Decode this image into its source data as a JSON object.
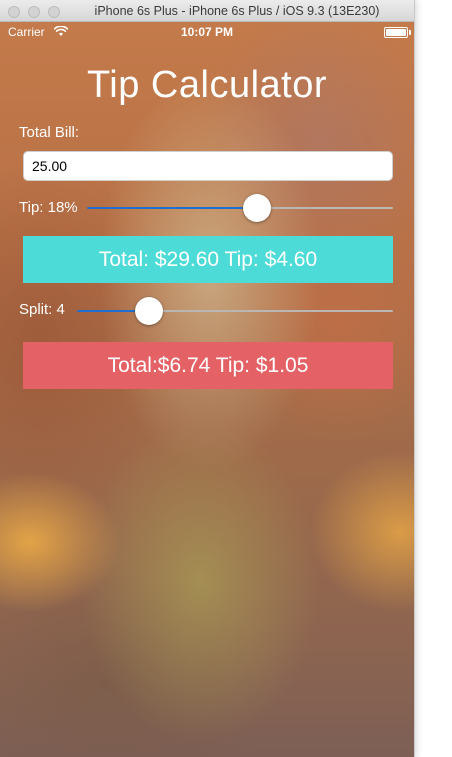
{
  "window": {
    "title": "iPhone 6s Plus - iPhone 6s Plus / iOS 9.3 (13E230)"
  },
  "status_bar": {
    "carrier": "Carrier",
    "time": "10:07 PM",
    "battery_level": 1.0,
    "wifi_icon": "wifi-icon",
    "battery_icon": "battery-icon"
  },
  "app": {
    "title": "Tip Calculator",
    "bill": {
      "label": "Total Bill:",
      "value": "25.00"
    },
    "tip": {
      "label": "Tip: 18%",
      "slider_fraction": 0.56
    },
    "total_result": {
      "text": "Total: $29.60 Tip: $4.60",
      "color": "#4ddbd7"
    },
    "split": {
      "label": "Split: 4",
      "slider_fraction": 0.2
    },
    "split_result": {
      "text": "Total:$6.74 Tip: $1.05",
      "color": "#e46265"
    },
    "slider_min_color": "#1f6fd1",
    "slider_max_color": "#b9b6b4"
  }
}
